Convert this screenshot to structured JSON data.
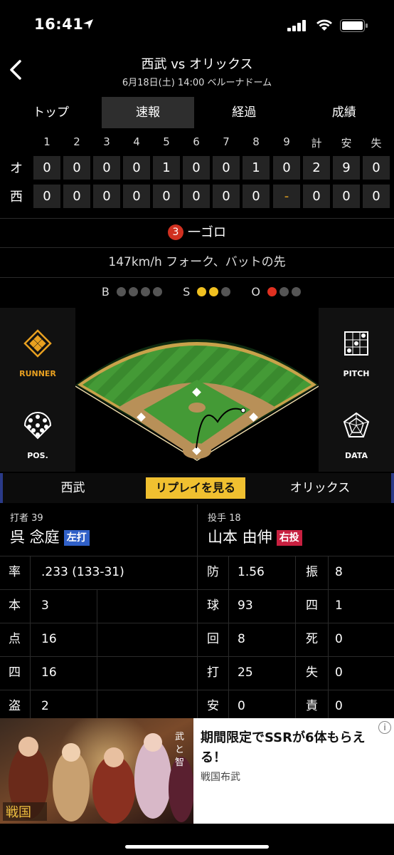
{
  "status": {
    "time": "16:41"
  },
  "header": {
    "title": "西武 vs オリックス",
    "subtitle": "6月18日(土) 14:00 ベルーナドーム"
  },
  "tabs": [
    "トップ",
    "速報",
    "経過",
    "成績"
  ],
  "scoreboard": {
    "headers": [
      "1",
      "2",
      "3",
      "4",
      "5",
      "6",
      "7",
      "8",
      "9",
      "計",
      "安",
      "失"
    ],
    "teams": [
      {
        "abbr": "オ",
        "cells": [
          "0",
          "0",
          "0",
          "0",
          "1",
          "0",
          "0",
          "1",
          "0",
          "2",
          "9",
          "0"
        ]
      },
      {
        "abbr": "西",
        "cells": [
          "0",
          "0",
          "0",
          "0",
          "0",
          "0",
          "0",
          "0",
          "-",
          "0",
          "0",
          "0"
        ]
      }
    ]
  },
  "play": {
    "number": "3",
    "result": "一ゴロ"
  },
  "pitch_info": "147km/h フォーク、バットの先",
  "count": {
    "ball_label": "B",
    "strike_label": "S",
    "out_label": "O",
    "balls": 0,
    "strikes": 2,
    "outs": 1
  },
  "side_buttons": {
    "runner": "RUNNER",
    "pitch": "PITCH",
    "pos": "POS.",
    "data": "DATA"
  },
  "teambar": {
    "home": "西武",
    "replay": "リプレイを見る",
    "away": "オリックス"
  },
  "batter": {
    "role": "打者 39",
    "name": "呉 念庭",
    "badge": "左打"
  },
  "pitcher": {
    "role": "投手 18",
    "name": "山本 由伸",
    "badge": "右投"
  },
  "batter_stats": [
    {
      "k": "率",
      "v": ".233 (133-31)"
    },
    {
      "k": "本",
      "v": "3"
    },
    {
      "k": "点",
      "v": "16"
    },
    {
      "k": "四",
      "v": "16"
    },
    {
      "k": "盗",
      "v": "2"
    }
  ],
  "pitcher_stats_left": [
    {
      "k": "防",
      "v": "1.56"
    },
    {
      "k": "球",
      "v": "93"
    },
    {
      "k": "回",
      "v": "8"
    },
    {
      "k": "打",
      "v": "25"
    },
    {
      "k": "安",
      "v": "0"
    }
  ],
  "pitcher_stats_right": [
    {
      "k": "振",
      "v": "8"
    },
    {
      "k": "四",
      "v": "1"
    },
    {
      "k": "死",
      "v": "0"
    },
    {
      "k": "失",
      "v": "0"
    },
    {
      "k": "責",
      "v": "0"
    }
  ],
  "ad": {
    "title": "期間限定でSSRが6体もらえる！",
    "sponsor": "戦国布武",
    "info": "i"
  },
  "colors": {
    "accent": "#f0c030",
    "out": "#e03020",
    "strike": "#f0c020",
    "lefty": "#3060c8",
    "righty": "#c82040"
  }
}
